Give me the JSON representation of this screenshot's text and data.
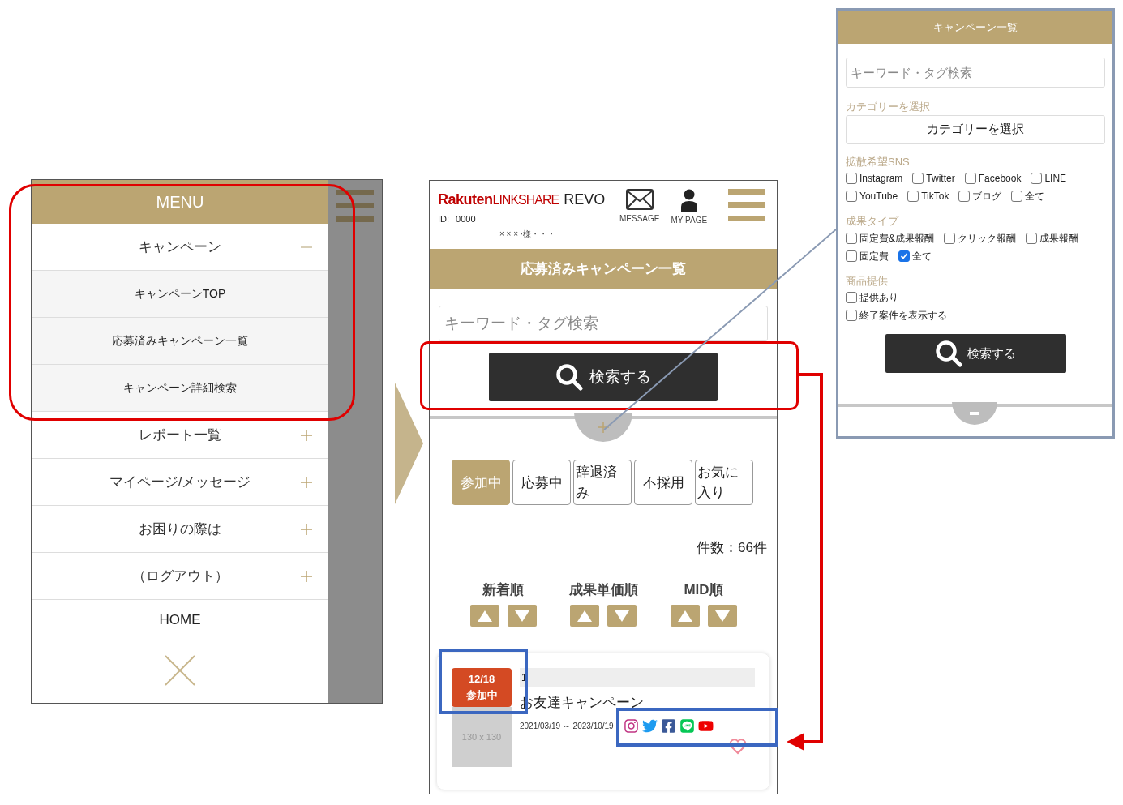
{
  "menu_screen": {
    "title": "MENU",
    "items": [
      {
        "label": "キャンペーン",
        "expanded": true,
        "children": [
          {
            "label": "キャンペーンTOP"
          },
          {
            "label": "応募済みキャンペーン一覧"
          },
          {
            "label": "キャンペーン詳細検索"
          }
        ]
      },
      {
        "label": "レポート一覧",
        "expanded": false
      },
      {
        "label": "マイページ/メッセージ",
        "expanded": false
      },
      {
        "label": "お困りの際は",
        "expanded": false
      },
      {
        "label": "（ログアウト）",
        "expanded": false
      }
    ],
    "home": "HOME"
  },
  "list_screen": {
    "brand": "Rakuten",
    "brand_sub": "LINKSHARE",
    "product": "REVO",
    "id_label": "ID:",
    "id_value": "0000",
    "user": "× × ×  ·様・・・",
    "nav": [
      {
        "label": "MESSAGE",
        "kind": "mail"
      },
      {
        "label": "MY PAGE",
        "kind": "person"
      }
    ],
    "title": "応募済みキャンペーン一覧",
    "search": {
      "placeholder": "キーワード・タグ検索"
    },
    "search_button": "検索する",
    "filters_expanded": false,
    "tabs": [
      {
        "label": "参加中",
        "selected": true
      },
      {
        "label": "応募中",
        "selected": false
      },
      {
        "label": "辞退済み",
        "selected": false
      },
      {
        "label": "不採用",
        "selected": false
      },
      {
        "label": "お気に入り",
        "selected": false
      }
    ],
    "count": "件数：66件",
    "sorts": [
      "新着順",
      "成果単価順",
      "MID順"
    ],
    "card": {
      "badge_date": "12/18",
      "badge_status": "参加中",
      "image": "130 x 130",
      "number": "1",
      "title": "お友達キャンペーン",
      "period": "2021/03/19 ～ 2023/10/19",
      "sns": [
        {
          "kind": "instagram"
        },
        {
          "kind": "twitter"
        },
        {
          "kind": "facebook"
        },
        {
          "kind": "line"
        },
        {
          "kind": "youtube"
        }
      ],
      "favorite": false
    }
  },
  "filter_screen": {
    "title": "キャンペーン一覧",
    "keyword": {
      "placeholder": "キーワード・タグ検索"
    },
    "category_label": "カテゴリーを選択",
    "category_select": "カテゴリーを選択",
    "groups": [
      {
        "label": "拡散希望SNS",
        "kind": "inline",
        "options": [
          {
            "label": "Instagram",
            "checked": false
          },
          {
            "label": "Twitter",
            "checked": false
          },
          {
            "label": "Facebook",
            "checked": false
          },
          {
            "label": "LINE",
            "checked": false
          },
          {
            "label": "YouTube",
            "checked": false
          },
          {
            "label": "TikTok",
            "checked": false
          },
          {
            "label": "ブログ",
            "checked": false
          },
          {
            "label": "全て",
            "checked": false
          }
        ]
      },
      {
        "label": "成果タイプ",
        "kind": "inline",
        "options": [
          {
            "label": "固定費&成果報酬",
            "checked": false
          },
          {
            "label": "クリック報酬",
            "checked": false
          },
          {
            "label": "成果報酬",
            "checked": false
          },
          {
            "label": "固定費",
            "checked": false
          },
          {
            "label": "全て",
            "checked": true
          }
        ]
      },
      {
        "label": "商品提供",
        "kind": "stacked",
        "options": [
          {
            "label": "提供あり",
            "checked": false
          },
          {
            "label": "終了案件を表示する",
            "checked": false
          }
        ]
      }
    ],
    "search_button": "検索する",
    "filters_expanded": true
  }
}
